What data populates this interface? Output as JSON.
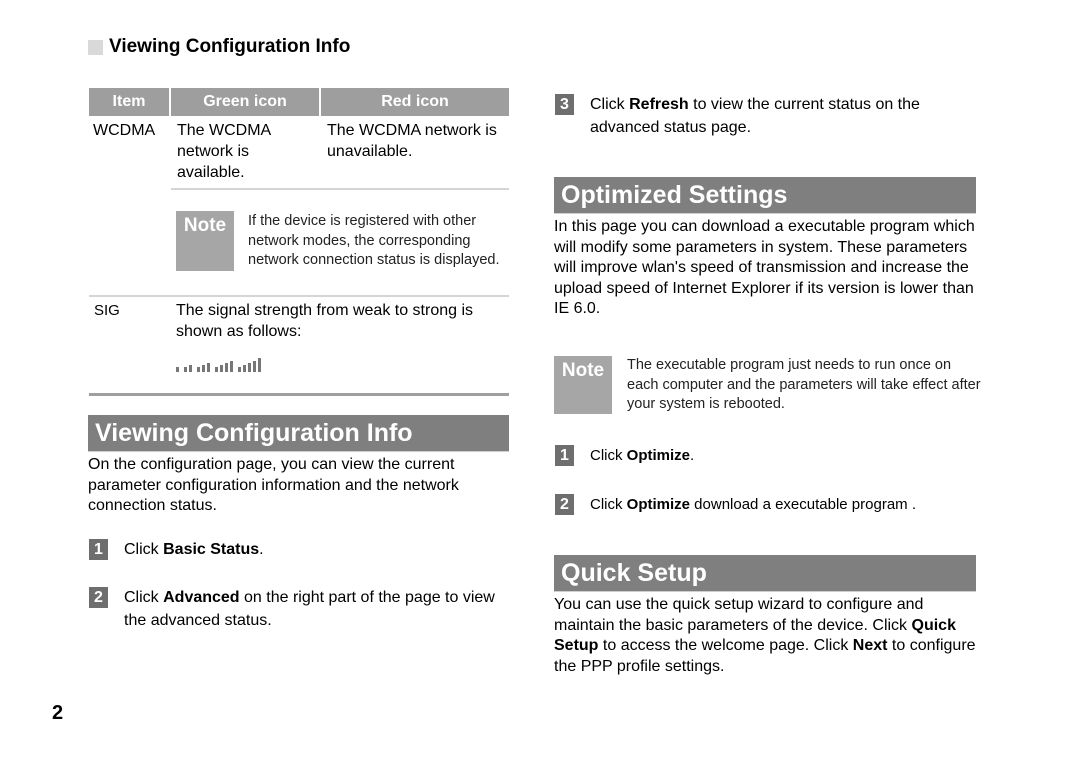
{
  "left_column": {
    "sub_heading": "Viewing Configuration Info",
    "table": {
      "headers": [
        "Item",
        "Green icon",
        "Red icon"
      ],
      "rows": [
        {
          "item": "WCDMA",
          "green": "The WCDMA network is available.",
          "red": "The WCDMA network is unavailable."
        }
      ],
      "note": {
        "label": "Note",
        "text": "If the device is registered with other network modes, the corresponding network connection status is displayed."
      },
      "sig_row": {
        "item": "SIG",
        "text": "The signal strength from weak to strong is shown as follows:",
        "levels": [
          1,
          2,
          3,
          4,
          5
        ]
      }
    },
    "section": {
      "title": "Viewing Configuration Info",
      "intro": "On the configuration page, you can view the current parameter configuration information and the network connection status.",
      "steps": [
        {
          "num": "1",
          "pre": "Click ",
          "bold": "Basic Status",
          "post": "."
        },
        {
          "num": "2",
          "pre": "Click ",
          "bold": "Advanced",
          "post": " on the right part of the page to view the advanced status."
        }
      ]
    }
  },
  "right_column": {
    "step3": {
      "num": "3",
      "pre": "Click ",
      "bold": "Refresh",
      "post": " to view the current status on the advanced status page."
    },
    "optimized": {
      "title": "Optimized Settings",
      "intro": "In this page you can download a executable program which will modify some parameters in system. These parameters will improve wlan's speed of transmission and increase the upload speed of Internet Explorer if its version is lower than IE 6.0.",
      "note": {
        "label": "Note",
        "text": "The executable program just needs to run once on each computer and the parameters will take effect after your system is rebooted."
      },
      "steps": [
        {
          "num": "1",
          "pre": "Click ",
          "bold": "Optimize",
          "post": "."
        },
        {
          "num": "2",
          "pre": "Click ",
          "bold": "Optimize",
          "post": " download a executable program ."
        }
      ]
    },
    "quick_setup": {
      "title": "Quick Setup",
      "text1": "You can use the quick setup wizard to configure and maintain the basic parameters of the device. Click ",
      "bold1": "Quick Setup",
      "text2": " to access the welcome page. Click ",
      "bold2": "Next",
      "text3": " to configure the PPP profile settings."
    }
  },
  "page_number": "2"
}
